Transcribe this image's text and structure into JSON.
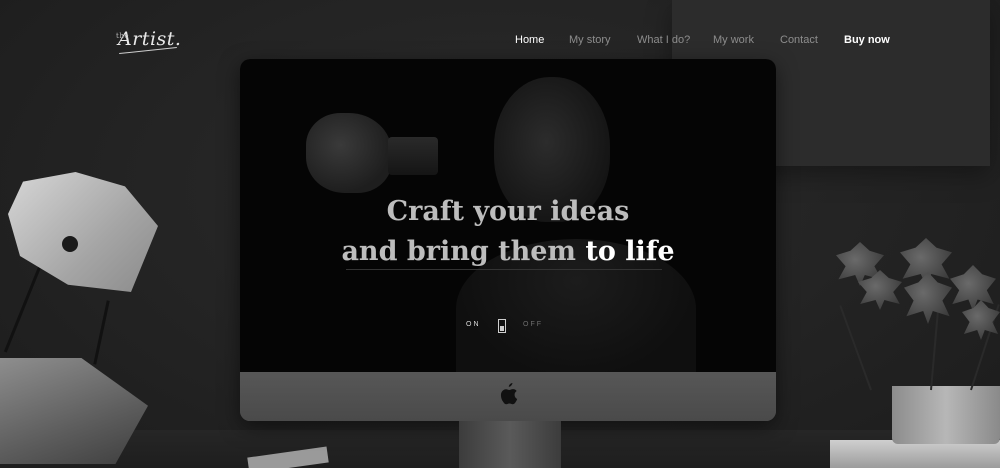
{
  "brand": {
    "logo_small": "the",
    "logo": "Artist."
  },
  "nav": {
    "items": [
      {
        "label": "Home",
        "state": "active"
      },
      {
        "label": "My story",
        "state": "default"
      },
      {
        "label": "What I do?",
        "state": "default"
      },
      {
        "label": "My work",
        "state": "default"
      },
      {
        "label": "Contact",
        "state": "default"
      },
      {
        "label": "Buy now",
        "state": "emphasis"
      }
    ]
  },
  "hero": {
    "line1": "Craft your ideas",
    "line2_prefix": "and bring them ",
    "line2_highlight": "to life"
  },
  "toggle": {
    "on_label": "ON",
    "off_label": "OFF",
    "state": "on"
  },
  "colors": {
    "background": "#222222",
    "text_active": "#ffffff",
    "text_muted": "#8d8d8d",
    "headline_muted": "#bdbdbd"
  },
  "icons": {
    "apple": "apple-logo-icon"
  }
}
